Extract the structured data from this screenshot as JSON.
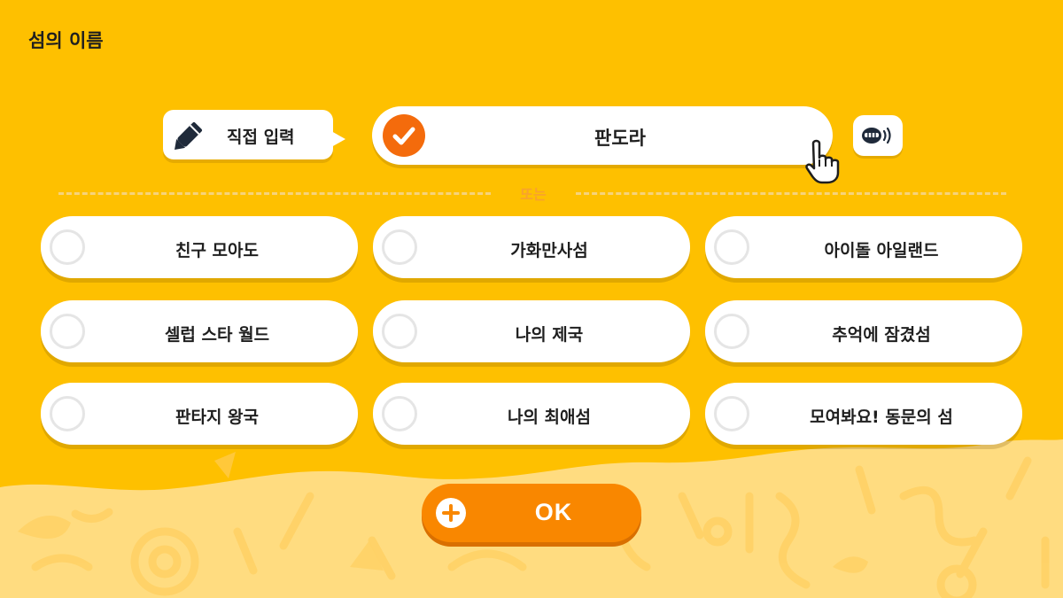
{
  "title": "섬의 이름",
  "direct_input": {
    "label": "직접 입력",
    "icon": "pencil-icon"
  },
  "name_field": {
    "value": "판도라",
    "selected": true,
    "icon": "check-icon"
  },
  "voice_button": {
    "icon": "voice-speak-icon"
  },
  "divider_label": "또는",
  "options": [
    {
      "label": "친구 모아도"
    },
    {
      "label": "가화만사섬"
    },
    {
      "label": "아이돌 아일랜드"
    },
    {
      "label": "셀럽 스타 월드"
    },
    {
      "label": "나의 제국"
    },
    {
      "label": "추억에 잠겼섬"
    },
    {
      "label": "판타지 왕국"
    },
    {
      "label": "나의 최애섬"
    },
    {
      "label": "모여봐요! 동문의 섬"
    }
  ],
  "ok_button": {
    "label": "OK",
    "icon": "plus-icon"
  },
  "colors": {
    "background": "#FEC000",
    "ground": "#FFDC80",
    "accent": "#F98700",
    "check": "#F46B0C",
    "divider_text": "#F8A22E"
  }
}
